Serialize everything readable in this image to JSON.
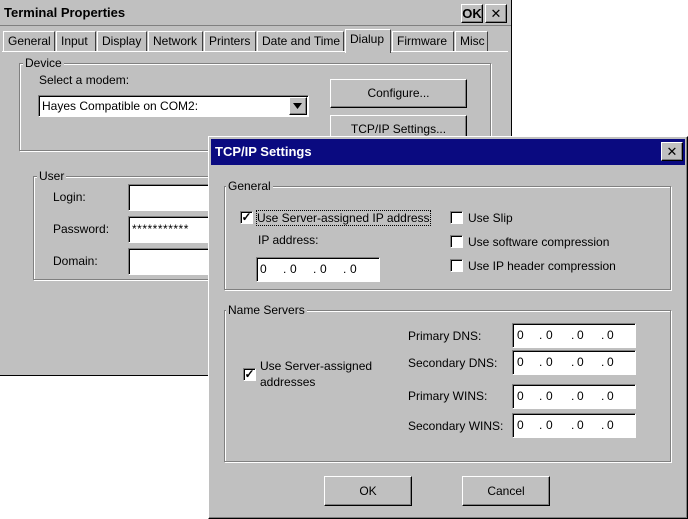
{
  "terminal": {
    "title": "Terminal Properties",
    "ok_label": "OK",
    "close_label": "✕",
    "tabs": [
      {
        "label": "General"
      },
      {
        "label": "Input"
      },
      {
        "label": "Display"
      },
      {
        "label": "Network"
      },
      {
        "label": "Printers"
      },
      {
        "label": "Date and Time"
      },
      {
        "label": "Dialup"
      },
      {
        "label": "Firmware"
      },
      {
        "label": "Misc"
      }
    ],
    "active_tab": "Dialup",
    "device": {
      "legend": "Device",
      "select_modem_label": "Select a modem:",
      "modem_value": "Hayes Compatible on COM2:",
      "configure_label": "Configure...",
      "tcpip_label": "TCP/IP Settings..."
    },
    "user": {
      "legend": "User",
      "login_label": "Login:",
      "login_value": "",
      "password_label": "Password:",
      "password_value": "***********",
      "domain_label": "Domain:",
      "domain_value": ""
    }
  },
  "tcpip": {
    "title": "TCP/IP Settings",
    "close_label": "✕",
    "general": {
      "legend": "General",
      "use_server_ip_label": "Use Server-assigned IP address",
      "use_server_ip_checked": true,
      "ip_address_label": "IP address:",
      "ip_address": [
        "0",
        "0",
        "0",
        "0"
      ],
      "use_slip_label": "Use Slip",
      "use_slip_checked": false,
      "use_sw_compression_label": "Use software compression",
      "use_sw_compression_checked": false,
      "use_ip_header_label": "Use IP header compression",
      "use_ip_header_checked": false
    },
    "name_servers": {
      "legend": "Name Servers",
      "use_server_addresses_label_line1": "Use Server-assigned",
      "use_server_addresses_label_line2": "addresses",
      "use_server_addresses_checked": true,
      "primary_dns_label": "Primary DNS:",
      "primary_dns": [
        "0",
        "0",
        "0",
        "0"
      ],
      "secondary_dns_label": "Secondary DNS:",
      "secondary_dns": [
        "0",
        "0",
        "0",
        "0"
      ],
      "primary_wins_label": "Primary WINS:",
      "primary_wins": [
        "0",
        "0",
        "0",
        "0"
      ],
      "secondary_wins_label": "Secondary WINS:",
      "secondary_wins": [
        "0",
        "0",
        "0",
        "0"
      ]
    },
    "ok_label": "OK",
    "cancel_label": "Cancel"
  },
  "colors": {
    "dialog_face": "#c0c0c0",
    "active_titlebar": "#0a0a80",
    "field_background": "#ffffff"
  }
}
